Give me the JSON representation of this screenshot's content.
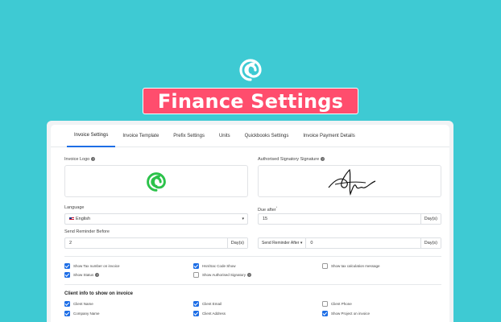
{
  "header": {
    "title": "Finance Settings",
    "brand_icon": "swirl-logo-icon",
    "colors": {
      "background": "#3ecad3",
      "banner": "#ff4d6d",
      "accent": "#1d6ee6",
      "logo_green": "#2bc24a"
    }
  },
  "tabs": [
    {
      "label": "Invoice Settings",
      "active": true
    },
    {
      "label": "Invoice Template",
      "active": false
    },
    {
      "label": "Prefix Settings",
      "active": false
    },
    {
      "label": "Units",
      "active": false
    },
    {
      "label": "Quickbooks Settings",
      "active": false
    },
    {
      "label": "Invoice Payment Details",
      "active": false
    }
  ],
  "invoice_logo": {
    "label": "Invoice Logo",
    "icon": "green-swirl-logo-icon"
  },
  "signature": {
    "label": "Authorised Signatory Signature",
    "icon": "signature-image"
  },
  "language": {
    "label": "Language",
    "value": "English",
    "flag_icon": "uk-flag-icon"
  },
  "due_after": {
    "label": "Due after",
    "required_mark": "*",
    "value": "15",
    "suffix": "Day(s)"
  },
  "send_reminder_before": {
    "label": "Send Reminder Before",
    "value": "2",
    "suffix": "Day(s)"
  },
  "send_reminder_after": {
    "select": "Send Reminder After",
    "value": "0",
    "suffix": "Day(s)"
  },
  "options": [
    {
      "label": "Show Tax number on invoice",
      "checked": true
    },
    {
      "label": "Hsn/Sac Code Show",
      "checked": true
    },
    {
      "label": "Show tax calculation message",
      "checked": false
    },
    {
      "label": "Show Status",
      "checked": true,
      "help": true
    },
    {
      "label": "Show Authorised Signatory",
      "checked": false,
      "help": true
    }
  ],
  "client_info": {
    "title": "Client info to show on invoice",
    "items": [
      {
        "label": "Client Name",
        "checked": true
      },
      {
        "label": "Client Email",
        "checked": true
      },
      {
        "label": "Client Phone",
        "checked": false
      },
      {
        "label": "Company Name",
        "checked": true
      },
      {
        "label": "Client Address",
        "checked": true
      },
      {
        "label": "Show Project on invoice",
        "checked": true
      }
    ]
  }
}
